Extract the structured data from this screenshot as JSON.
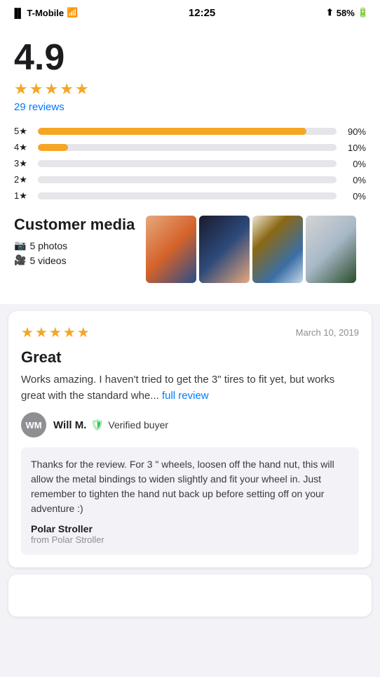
{
  "statusBar": {
    "carrier": "T-Mobile",
    "time": "12:25",
    "battery": "58%"
  },
  "ratingOverview": {
    "score": "4.9",
    "reviewsLink": "29 reviews",
    "bars": [
      {
        "label": "5★",
        "pct": 90,
        "pctLabel": "90%"
      },
      {
        "label": "4★",
        "pct": 10,
        "pctLabel": "10%"
      },
      {
        "label": "3★",
        "pct": 0,
        "pctLabel": "0%"
      },
      {
        "label": "2★",
        "pct": 0,
        "pctLabel": "0%"
      },
      {
        "label": "1★",
        "pct": 0,
        "pctLabel": "0%"
      }
    ]
  },
  "customerMedia": {
    "title": "Customer media",
    "photoCount": "5 photos",
    "videoCount": "5 videos"
  },
  "review": {
    "stars": 5,
    "date": "March 10, 2019",
    "title": "Great",
    "text": "Works amazing. I haven't tried to get the 3\" tires to fit yet, but works great with the standard whe...",
    "readMoreLabel": "full review",
    "reviewer": {
      "initials": "WM",
      "name": "Will M.",
      "verified": "Verified buyer"
    },
    "sellerResponse": {
      "text": "Thanks for the review. For 3 \" wheels, loosen off the hand nut, this will allow the metal bindings to widen slightly and fit your wheel in. Just remember to tighten the hand nut back up before setting off on your adventure :)",
      "sellerName": "Polar Stroller",
      "sellerFrom": "from Polar Stroller"
    }
  }
}
